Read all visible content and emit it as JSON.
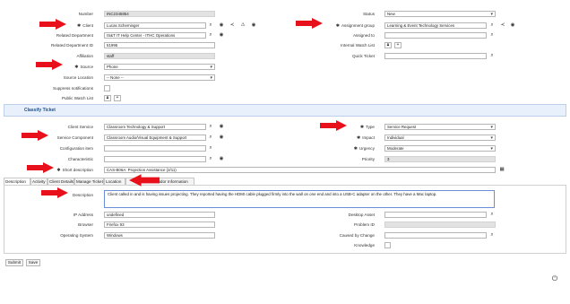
{
  "form": {
    "number": {
      "label": "Number",
      "value": "INC2345854"
    },
    "client": {
      "label": "Client",
      "value": "Lucas Scheminger"
    },
    "related_department": {
      "label": "Related Department",
      "value": "IS&T IT Help Center - ITHC Operations"
    },
    "related_department_id": {
      "label": "Related Department ID",
      "value": "51995"
    },
    "affiliation": {
      "label": "Affiliation",
      "value": "staff"
    },
    "source": {
      "label": "Source",
      "value": "Phone"
    },
    "source_location": {
      "label": "Source Location",
      "value": "-- None --"
    },
    "suppress_notifications": {
      "label": "Suppress notifications"
    },
    "public_watch_list": {
      "label": "Public Watch List"
    },
    "status": {
      "label": "Status",
      "value": "New"
    },
    "assignment_group": {
      "label": "Assignment group",
      "value": "Learning & Event Technology Services"
    },
    "assigned_to": {
      "label": "Assigned to",
      "value": ""
    },
    "internal_watch_list": {
      "label": "Internal Watch List"
    },
    "quick_ticket": {
      "label": "Quick Ticket",
      "value": ""
    }
  },
  "section_title": "Classify Ticket",
  "classify": {
    "client_service": {
      "label": "Client Service",
      "value": "Classroom Technology & Support"
    },
    "service_component": {
      "label": "Service Component",
      "value": "Classroom Audio/Visual Equipment & Support"
    },
    "configuration_item": {
      "label": "Configuration item",
      "value": ""
    },
    "characteristic": {
      "label": "Characteristic",
      "value": ""
    },
    "short_description": {
      "label": "Short description",
      "value": "CAS-B06A: Projection Assistance (2/11)"
    },
    "type": {
      "label": "Type",
      "value": "Service Request"
    },
    "impact": {
      "label": "Impact",
      "value": "Individual"
    },
    "urgency": {
      "label": "Urgency",
      "value": "Moderate"
    },
    "priority": {
      "label": "Priority",
      "value": "3"
    }
  },
  "tabs": [
    "Description",
    "Activity",
    "Client Details",
    "Manage Ticket",
    "Location",
    "Vendor Information"
  ],
  "details": {
    "description": {
      "label": "Description",
      "value": "Client called in and is having issues projecting. They reported having the HDMI cable plugged firmly into the wall on one end and into a USB-C adapter on the other. They have a Mac laptop."
    },
    "ip_address": {
      "label": "IP Address",
      "value": "undefined"
    },
    "browser": {
      "label": "Browser",
      "value": "Firefox 93"
    },
    "operating_system": {
      "label": "Operating System",
      "value": "Windows"
    },
    "desktop_asset": {
      "label": "Desktop Asset",
      "value": ""
    },
    "problem_id": {
      "label": "Problem ID",
      "value": ""
    },
    "caused_by_change": {
      "label": "Caused by Change",
      "value": ""
    },
    "knowledge": {
      "label": "Knowledge"
    }
  },
  "buttons": {
    "submit": "Submit",
    "save": "Save"
  },
  "colors": {
    "arrow": "#e8111b",
    "section_bg": "#e7f0fb",
    "readonly_bg": "#e2e2e2"
  },
  "icons": [
    "search-icon",
    "eye-icon",
    "share-icon",
    "alert-icon",
    "lock-icon",
    "add-user-icon",
    "calendar-icon",
    "settings-icon",
    "help-icon"
  ]
}
